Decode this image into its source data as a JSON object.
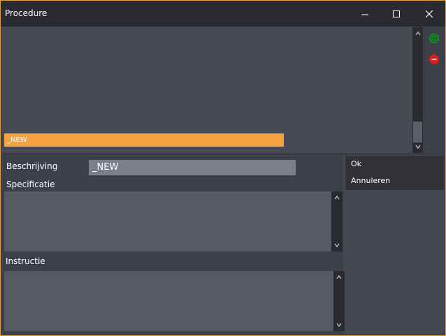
{
  "window": {
    "title": "Procedure",
    "border_color": "#e0a13a",
    "controls": [
      "minimize-icon",
      "maximize-icon",
      "close-icon"
    ]
  },
  "procedure_list": {
    "items": [
      {
        "label": "_NEW",
        "selected": true,
        "highlight_color": "#f6a23e"
      }
    ]
  },
  "list_actions": {
    "add_icon": "plus-circle-icon",
    "add_color": "#1a8a2a",
    "remove_icon": "minus-circle-icon",
    "remove_color": "#e01b1b"
  },
  "form": {
    "beschrijving_label": "Beschrijving",
    "beschrijving_value": "_NEW",
    "specificatie_label": "Specificatie",
    "specificatie_value": "",
    "instructie_label": "Instructie",
    "instructie_value": ""
  },
  "actions": {
    "ok_label": "Ok",
    "annuleren_label": "Annuleren"
  }
}
